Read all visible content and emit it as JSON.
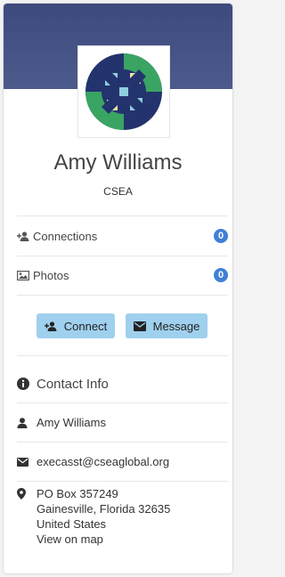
{
  "profile": {
    "name": "Amy Williams",
    "organization": "CSEA"
  },
  "stats": [
    {
      "label": "Connections",
      "count": "0",
      "icon": "user-plus-icon"
    },
    {
      "label": "Photos",
      "count": "0",
      "icon": "image-icon"
    }
  ],
  "actions": {
    "connect_label": "Connect",
    "message_label": "Message"
  },
  "contact": {
    "title": "Contact Info",
    "name": "Amy Williams",
    "email": "execasst@cseaglobal.org",
    "address_line1": "PO Box 357249",
    "address_line2": "Gainesville, Florida 32635",
    "country": "United States",
    "map_link": "View on map"
  },
  "colors": {
    "banner": "#46538a",
    "badge": "#3f7fd6",
    "button": "#9fd0ee",
    "card": "#ffffff"
  }
}
